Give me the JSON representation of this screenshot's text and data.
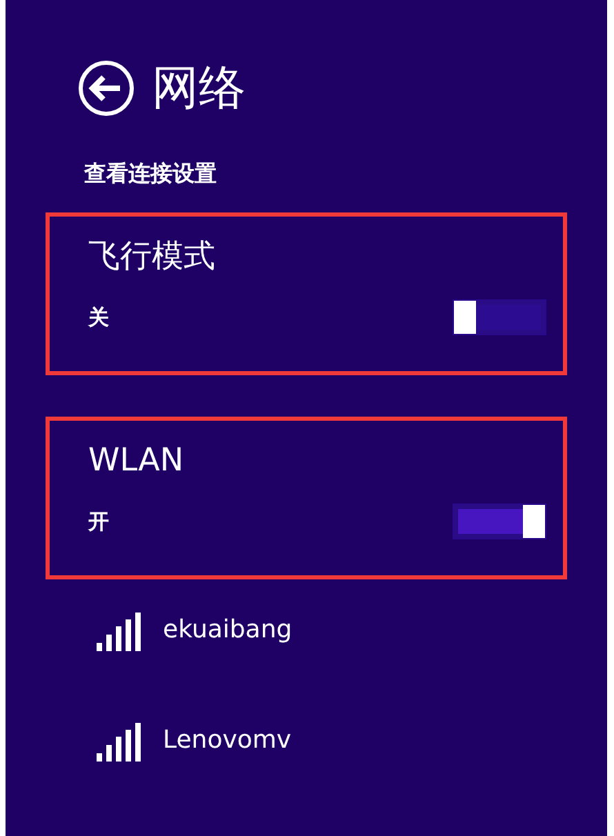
{
  "header": {
    "title": "网络"
  },
  "subtitle": "查看连接设置",
  "sections": [
    {
      "title": "飞行模式",
      "state_label": "关",
      "on": false,
      "highlighted": true
    },
    {
      "title": "WLAN",
      "state_label": "开",
      "on": true,
      "highlighted": true
    }
  ],
  "networks": [
    {
      "name": "ekuaibang"
    },
    {
      "name": "Lenovomv"
    }
  ]
}
